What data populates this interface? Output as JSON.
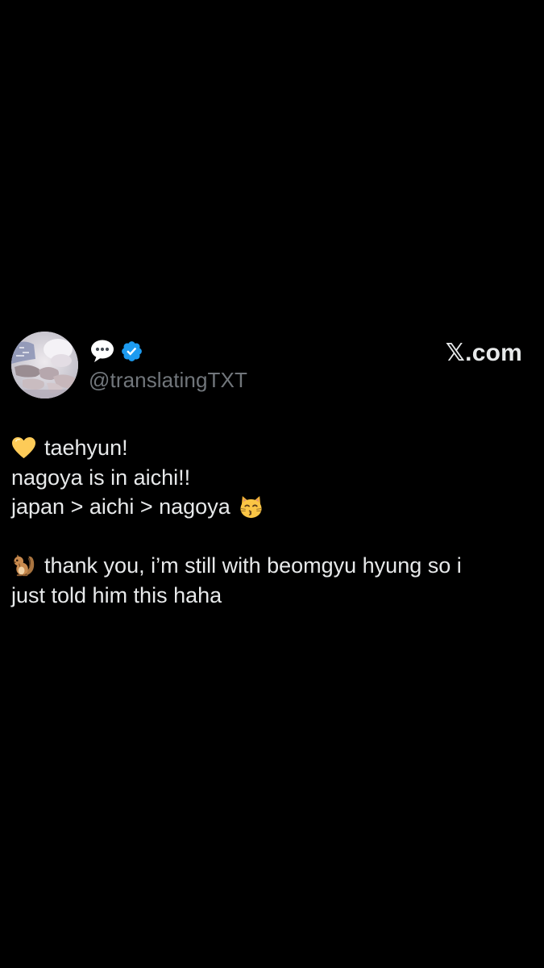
{
  "post": {
    "avatar_icon": "profile-photo-hands",
    "name_icon": "speech-balloon-emoji",
    "verified_icon": "verified-badge",
    "handle": "@translatingTXT",
    "watermark": "𝕏.com",
    "accent_color": "#1d9bf0",
    "handle_color": "#71767b",
    "text_color": "#e7e9ea",
    "background_color": "#000000"
  },
  "tweet": {
    "lines": [
      {
        "emoji_before": "yellow-heart",
        "text": "taehyun!"
      },
      {
        "text": "nagoya is in aichi!!"
      },
      {
        "text": "japan > aichi > nagoya",
        "emoji_after": "kissing-cat"
      },
      {
        "text": ""
      },
      {
        "emoji_before": "chipmunk",
        "text": "thank you, i’m still with beomgyu hyung so i"
      },
      {
        "text": "just told him this haha"
      }
    ]
  }
}
